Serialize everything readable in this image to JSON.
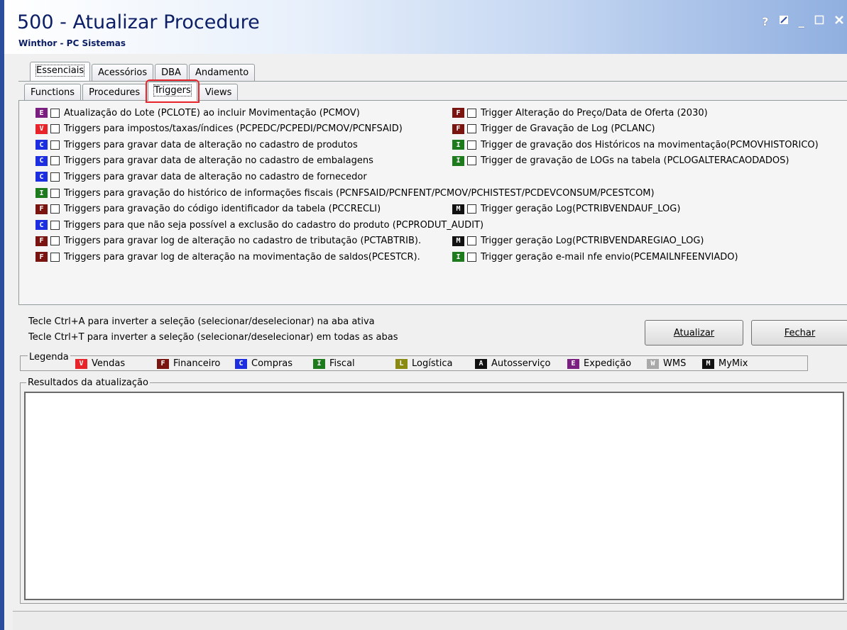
{
  "window": {
    "title": "500 - Atualizar Procedure",
    "subtitle": "Winthor - PC Sistemas",
    "controls": {
      "help": "?",
      "minimize": "_"
    }
  },
  "tabs_row1": [
    {
      "label": "Essenciais",
      "active": true
    },
    {
      "label": "Acessórios"
    },
    {
      "label": "DBA"
    },
    {
      "label": "Andamento"
    }
  ],
  "tabs_row2": [
    {
      "label": "Functions"
    },
    {
      "label": "Procedures"
    },
    {
      "label": "Triggers",
      "active": true,
      "highlighted": true
    },
    {
      "label": "Views"
    }
  ],
  "items_left": [
    {
      "badge": "E",
      "color": "#7a1f80",
      "label": "Atualização do Lote (PCLOTE) ao incluir Movimentação (PCMOV)"
    },
    {
      "badge": "V",
      "color": "#e8232a",
      "label": "Triggers para impostos/taxas/índices (PCPEDC/PCPEDI/PCMOV/PCNFSAID)"
    },
    {
      "badge": "C",
      "color": "#1c2ee0",
      "label": "Triggers para gravar data de alteração no cadastro de produtos"
    },
    {
      "badge": "C",
      "color": "#1c2ee0",
      "label": "Triggers para gravar data de alteração no cadastro de embalagens"
    },
    {
      "badge": "C",
      "color": "#1c2ee0",
      "label": "Triggers para gravar data de alteração no cadastro de fornecedor"
    },
    {
      "badge": "I",
      "color": "#1d7a1d",
      "label": "Triggers para gravação do histórico de informações fiscais (PCNFSAID/PCNFENT/PCMOV/PCHISTEST/PCDEVCONSUM/PCESTCOM)"
    },
    {
      "badge": "F",
      "color": "#7a1410",
      "label": "Triggers para gravação do código identificador da tabela (PCCRECLI)"
    },
    {
      "badge": "C",
      "color": "#1c2ee0",
      "label": "Triggers para que não seja possível a exclusão do cadastro do produto (PCPRODUT_AUDIT)"
    },
    {
      "badge": "F",
      "color": "#7a1410",
      "label": "Triggers para gravar log de alteração no cadastro de tributação (PCTABTRIB)."
    },
    {
      "badge": "F",
      "color": "#7a1410",
      "label": "Triggers para gravar log de alteração na movimentação de saldos(PCESTCR)."
    }
  ],
  "items_right": [
    {
      "row": 0,
      "badge": "F",
      "color": "#7a1410",
      "label": "Trigger Alteração do Preço/Data de Oferta (2030)"
    },
    {
      "row": 1,
      "badge": "F",
      "color": "#7a1410",
      "label": "Trigger de Gravação de Log (PCLANC)"
    },
    {
      "row": 2,
      "badge": "I",
      "color": "#1d7a1d",
      "label": "Trigger de gravação dos Históricos na movimentação(PCMOVHISTORICO)"
    },
    {
      "row": 3,
      "badge": "I",
      "color": "#1d7a1d",
      "label": "Trigger de gravação de LOGs na tabela (PCLOGALTERACAODADOS)"
    },
    {
      "row": 6,
      "badge": "M",
      "color": "#111111",
      "label": "Trigger geração Log(PCTRIBVENDAUF_LOG)"
    },
    {
      "row": 8,
      "badge": "M",
      "color": "#111111",
      "label": "Trigger geração Log(PCTRIBVENDAREGIAO_LOG)"
    },
    {
      "row": 9,
      "badge": "I",
      "color": "#1d7a1d",
      "label": "Trigger geração e-mail nfe envio(PCEMAILNFEENVIADO)"
    }
  ],
  "hints": [
    "Tecle Ctrl+A para inverter a seleção (selecionar/deselecionar) na aba ativa",
    "Tecle Ctrl+T para inverter a seleção (selecionar/deselecionar) em todas as abas"
  ],
  "buttons": {
    "update": "Atualizar",
    "close": "Fechar"
  },
  "legend": {
    "title": "Legenda",
    "items": [
      {
        "badge": "V",
        "color": "#e8232a",
        "label": "Vendas"
      },
      {
        "badge": "F",
        "color": "#7a1410",
        "label": "Financeiro"
      },
      {
        "badge": "C",
        "color": "#1c2ee0",
        "label": "Compras"
      },
      {
        "badge": "I",
        "color": "#1d7a1d",
        "label": "Fiscal"
      },
      {
        "badge": "L",
        "color": "#8a8a10",
        "label": "Logística"
      },
      {
        "badge": "A",
        "color": "#111111",
        "label": "Autosserviço"
      },
      {
        "badge": "E",
        "color": "#7a1f80",
        "label": "Expedição"
      },
      {
        "badge": "W",
        "color": "#a9a9a9",
        "label": "WMS"
      },
      {
        "badge": "M",
        "color": "#111111",
        "label": "MyMix"
      }
    ]
  },
  "results": {
    "title": "Resultados da atualização"
  }
}
